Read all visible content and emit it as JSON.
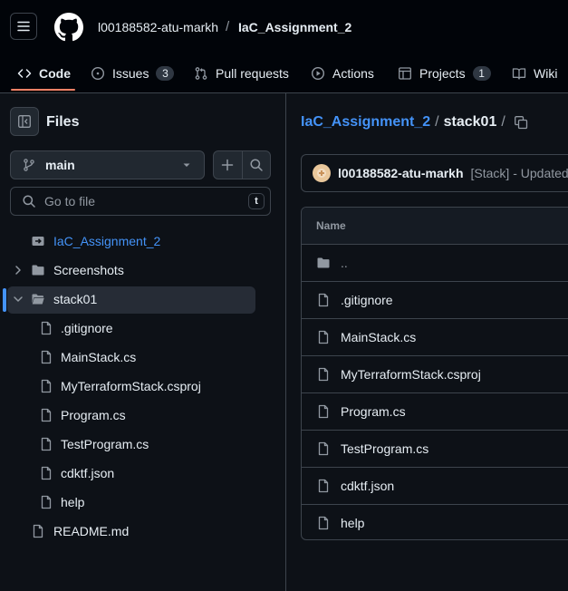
{
  "colors": {
    "bg": "#0d1117",
    "header_bg": "#010409",
    "accent": "#4493f8",
    "active_tab_underline": "#f78166",
    "border": "#3d444d"
  },
  "header": {
    "owner": "l00188582-atu-markh",
    "separator": "/",
    "repo": "IaC_Assignment_2"
  },
  "tabs": [
    {
      "label": "Code",
      "icon": "code-icon",
      "active": true
    },
    {
      "label": "Issues",
      "icon": "issue-opened-icon",
      "count": "3"
    },
    {
      "label": "Pull requests",
      "icon": "git-pull-request-icon"
    },
    {
      "label": "Actions",
      "icon": "play-icon"
    },
    {
      "label": "Projects",
      "icon": "table-icon",
      "count": "1"
    },
    {
      "label": "Wiki",
      "icon": "book-icon"
    }
  ],
  "sidebar": {
    "title": "Files",
    "branch": "main",
    "goto_placeholder": "Go to file",
    "goto_shortcut": "t",
    "tree": [
      {
        "label": "IaC_Assignment_2",
        "type": "repo-link"
      },
      {
        "label": "Screenshots",
        "type": "folder",
        "expanded": false
      },
      {
        "label": "stack01",
        "type": "folder",
        "expanded": true,
        "selected": true
      },
      {
        "label": ".gitignore",
        "type": "file"
      },
      {
        "label": "MainStack.cs",
        "type": "file"
      },
      {
        "label": "MyTerraformStack.csproj",
        "type": "file"
      },
      {
        "label": "Program.cs",
        "type": "file"
      },
      {
        "label": "TestProgram.cs",
        "type": "file"
      },
      {
        "label": "cdktf.json",
        "type": "file"
      },
      {
        "label": "help",
        "type": "file"
      },
      {
        "label": "README.md",
        "type": "file"
      }
    ]
  },
  "main": {
    "breadcrumb": {
      "repo": "IaC_Assignment_2",
      "folder": "stack01",
      "separator": "/"
    },
    "commit": {
      "author": "l00188582-atu-markh",
      "message": "[Stack] - Updated"
    },
    "table": {
      "header": "Name",
      "rows": [
        {
          "name": "..",
          "type": "parent"
        },
        {
          "name": ".gitignore",
          "type": "file"
        },
        {
          "name": "MainStack.cs",
          "type": "file"
        },
        {
          "name": "MyTerraformStack.csproj",
          "type": "file"
        },
        {
          "name": "Program.cs",
          "type": "file"
        },
        {
          "name": "TestProgram.cs",
          "type": "file"
        },
        {
          "name": "cdktf.json",
          "type": "file"
        },
        {
          "name": "help",
          "type": "file"
        }
      ]
    }
  }
}
